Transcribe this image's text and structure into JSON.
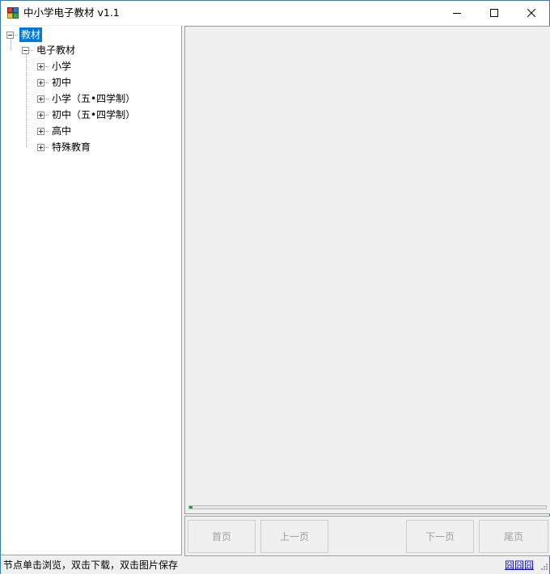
{
  "window": {
    "title": "中小学电子教材 v1.1",
    "icons": [
      "app-icon",
      "minimize-icon",
      "maximize-icon",
      "close-icon"
    ]
  },
  "tree": {
    "root": {
      "label": "教材",
      "expanded": true,
      "selected": true
    },
    "child": {
      "label": "电子教材",
      "expanded": true
    },
    "items": [
      {
        "label": "小学",
        "expanded": false
      },
      {
        "label": "初中",
        "expanded": false
      },
      {
        "label": "小学（五•四学制）",
        "expanded": false
      },
      {
        "label": "初中（五•四学制）",
        "expanded": false
      },
      {
        "label": "高中",
        "expanded": false
      },
      {
        "label": "特殊教育",
        "expanded": false
      }
    ]
  },
  "viewer": {
    "progress": 0.01
  },
  "nav": {
    "first": "首页",
    "prev": "上一页",
    "next": "下一页",
    "last": "尾页"
  },
  "status": {
    "hint": "节点单击浏览，双击下载，双击图片保存",
    "link": "囧囧囧"
  },
  "colors": {
    "accent": "#0078d7",
    "progress": "#06b025",
    "link": "#0000ff"
  }
}
